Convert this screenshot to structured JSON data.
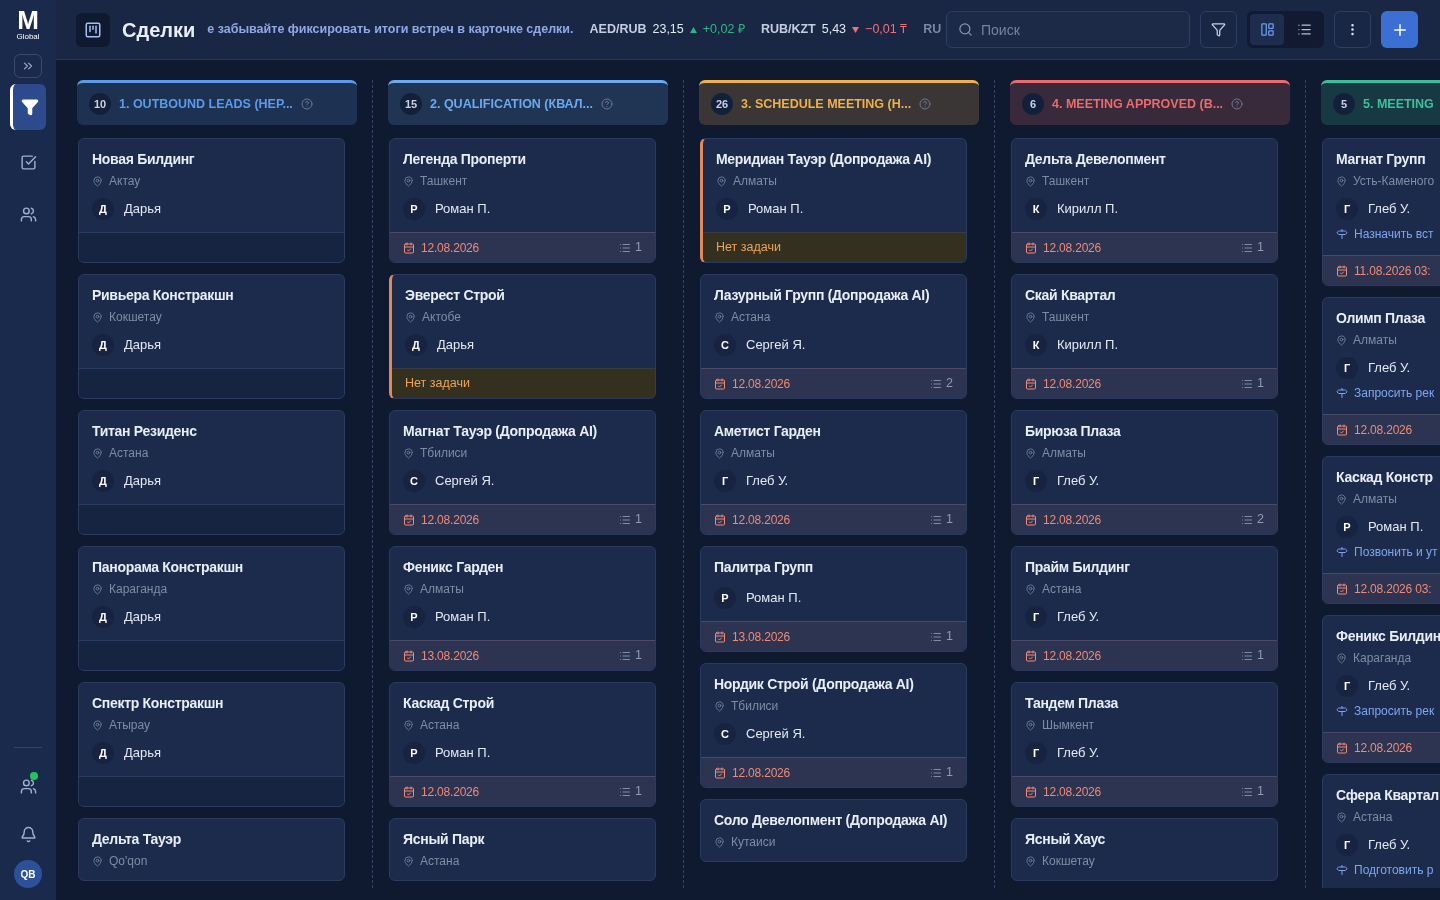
{
  "sidebar": {
    "logo": {
      "mark": "M",
      "sub": "Global"
    },
    "nav": [
      {
        "kind": "deals",
        "selected": true
      },
      {
        "kind": "tasks",
        "selected": false
      },
      {
        "kind": "contacts",
        "selected": false
      }
    ],
    "team": {
      "online": true
    },
    "avatar": "QB"
  },
  "header": {
    "title": "Сделки",
    "notice": "е забывайте фиксировать итоги встреч в карточке сделки.",
    "rates": [
      {
        "pair": "AED/RUB",
        "value": "23,15",
        "up": true,
        "change": "+0,02 ₽"
      },
      {
        "pair": "RUB/KZT",
        "value": "5,43",
        "up": false,
        "change": "−0,01 ₸"
      }
    ],
    "rates_cut": "RU",
    "search": {
      "placeholder": "Поиск"
    },
    "view_modes": [
      {
        "kind": "board",
        "selected": true
      },
      {
        "kind": "list",
        "selected": false
      }
    ]
  },
  "columns": [
    {
      "count": "10",
      "title": "1. OUTBOUND LEADS (НЕР...",
      "color": "#5b9bea",
      "help": true,
      "cards": [
        {
          "title": "Новая Билдинг",
          "city": "Актау",
          "initial": "Д",
          "assignee": "Дарья",
          "footer": {
            "kind": "empty"
          }
        },
        {
          "title": "Ривьера Констракшн",
          "city": "Кокшетау",
          "initial": "Д",
          "assignee": "Дарья",
          "footer": {
            "kind": "empty"
          }
        },
        {
          "title": "Титан Резиденс",
          "city": "Астана",
          "initial": "Д",
          "assignee": "Дарья",
          "footer": {
            "kind": "empty"
          }
        },
        {
          "title": "Панорама Констракшн",
          "city": "Караганда",
          "initial": "Д",
          "assignee": "Дарья",
          "footer": {
            "kind": "empty"
          }
        },
        {
          "title": "Спектр Констракшн",
          "city": "Атырау",
          "initial": "Д",
          "assignee": "Дарья",
          "footer": {
            "kind": "empty"
          }
        },
        {
          "title": "Дельта Тауэр",
          "city": "Qo'qon"
        }
      ]
    },
    {
      "count": "15",
      "title": "2. QUALIFICATION (КВАЛ...",
      "color": "#6aaaf0",
      "help": true,
      "cards": [
        {
          "title": "Легенда Проперти",
          "city": "Ташкент",
          "initial": "Р",
          "assignee": "Роман П.",
          "footer": {
            "kind": "task",
            "date": "12.08.2026",
            "tasks": "1"
          }
        },
        {
          "title": "Эверест Строй",
          "city": "Актобе",
          "initial": "Д",
          "assignee": "Дарья",
          "footer": {
            "kind": "no_task",
            "text": "Нет задачи"
          }
        },
        {
          "title": "Магнат Тауэр (Допродажа AI)",
          "city": "Тбилиси",
          "initial": "С",
          "assignee": "Сергей Я.",
          "footer": {
            "kind": "task",
            "date": "12.08.2026",
            "tasks": "1"
          }
        },
        {
          "title": "Феникс Гарден",
          "city": "Алматы",
          "initial": "Р",
          "assignee": "Роман П.",
          "footer": {
            "kind": "task",
            "date": "13.08.2026",
            "tasks": "1"
          }
        },
        {
          "title": "Каскад Строй",
          "city": "Астана",
          "initial": "Р",
          "assignee": "Роман П.",
          "footer": {
            "kind": "task",
            "date": "12.08.2026",
            "tasks": "1"
          }
        },
        {
          "title": "Ясный Парк",
          "city": "Астана"
        }
      ]
    },
    {
      "count": "26",
      "title": "3. SCHEDULE MEETING (Н...",
      "color": "#f0b04a",
      "help": true,
      "cards": [
        {
          "title": "Меридиан Тауэр (Допродажа AI)",
          "city": "Алматы",
          "initial": "Р",
          "assignee": "Роман П.",
          "footer": {
            "kind": "no_task",
            "text": "Нет задачи"
          }
        },
        {
          "title": "Лазурный Групп (Допродажа AI)",
          "city": "Астана",
          "initial": "С",
          "assignee": "Сергей Я.",
          "footer": {
            "kind": "task",
            "date": "12.08.2026",
            "tasks": "2"
          }
        },
        {
          "title": "Аметист Гарден",
          "city": "Алматы",
          "initial": "Г",
          "assignee": "Глеб У.",
          "footer": {
            "kind": "task",
            "date": "12.08.2026",
            "tasks": "1"
          }
        },
        {
          "title": "Палитра Групп",
          "initial": "Р",
          "assignee": "Роман П.",
          "footer": {
            "kind": "task",
            "date": "13.08.2026",
            "tasks": "1"
          }
        },
        {
          "title": "Нордик Строй (Допродажа AI)",
          "city": "Тбилиси",
          "initial": "С",
          "assignee": "Сергей Я.",
          "footer": {
            "kind": "task",
            "date": "12.08.2026",
            "tasks": "1"
          }
        },
        {
          "title": "Соло Девелопмент (Допродажа AI)",
          "city": "Кутаиси"
        }
      ]
    },
    {
      "count": "6",
      "title": "4. MEETING APPROVED (В...",
      "color": "#ec6b6b",
      "help": true,
      "cards": [
        {
          "title": "Дельта Девелопмент",
          "city": "Ташкент",
          "initial": "К",
          "assignee": "Кирилл П.",
          "footer": {
            "kind": "task",
            "date": "12.08.2026",
            "tasks": "1"
          }
        },
        {
          "title": "Скай Квартал",
          "city": "Ташкент",
          "initial": "К",
          "assignee": "Кирилл П.",
          "footer": {
            "kind": "task",
            "date": "12.08.2026",
            "tasks": "1"
          }
        },
        {
          "title": "Бирюза Плаза",
          "city": "Алматы",
          "initial": "Г",
          "assignee": "Глеб У.",
          "footer": {
            "kind": "task",
            "date": "12.08.2026",
            "tasks": "2"
          }
        },
        {
          "title": "Прайм Билдинг",
          "city": "Астана",
          "initial": "Г",
          "assignee": "Глеб У.",
          "footer": {
            "kind": "task",
            "date": "12.08.2026",
            "tasks": "1"
          }
        },
        {
          "title": "Тандем Плаза",
          "city": "Шымкент",
          "initial": "Г",
          "assignee": "Глеб У.",
          "footer": {
            "kind": "task",
            "date": "12.08.2026",
            "tasks": "1"
          }
        },
        {
          "title": "Ясный Хаус",
          "city": "Кокшетау"
        }
      ]
    },
    {
      "count": "5",
      "title": "5. MEETING",
      "color": "#3cc09a",
      "cards": [
        {
          "title": "Магнат Групп",
          "city": "Усть-Каменого",
          "initial": "Г",
          "assignee": "Глеб У.",
          "action": "Назначить вст",
          "footer": {
            "kind": "task",
            "date": "11.08.2026 03:"
          }
        },
        {
          "title": "Олимп Плаза",
          "city": "Алматы",
          "initial": "Г",
          "assignee": "Глеб У.",
          "action": "Запросить рек",
          "footer": {
            "kind": "task",
            "date": "12.08.2026"
          }
        },
        {
          "title": "Каскад Констр",
          "city": "Алматы",
          "initial": "Р",
          "assignee": "Роман П.",
          "action": "Позвонить и ут",
          "footer": {
            "kind": "task",
            "date": "12.08.2026 03:"
          }
        },
        {
          "title": "Феникс Билдин",
          "city": "Караганда",
          "initial": "Г",
          "assignee": "Глеб У.",
          "action": "Запросить рек",
          "footer": {
            "kind": "task",
            "date": "12.08.2026"
          }
        },
        {
          "title": "Сфера Квартал",
          "city": "Астана",
          "initial": "Г",
          "assignee": "Глеб У.",
          "action": "Подготовить р"
        }
      ]
    }
  ]
}
